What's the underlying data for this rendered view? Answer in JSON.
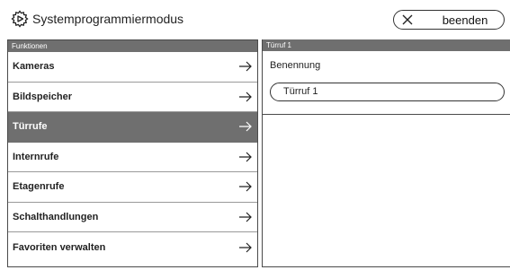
{
  "header": {
    "title": "Systemprogrammiermodus",
    "settings_icon": "gear-icon",
    "exit_icon": "close-icon",
    "exit_label": "beenden"
  },
  "left": {
    "section_title": "Funktionen",
    "items": [
      {
        "label": "Kameras",
        "icon": "arrow-right-icon",
        "active": false
      },
      {
        "label": "Bildspeicher",
        "icon": "arrow-right-icon",
        "active": false
      },
      {
        "label": "Türrufe",
        "icon": "arrow-right-icon",
        "active": true
      },
      {
        "label": "Internrufe",
        "icon": "arrow-right-icon",
        "active": false
      },
      {
        "label": "Etagenrufe",
        "icon": "arrow-right-icon",
        "active": false
      },
      {
        "label": "Schalthandlungen",
        "icon": "arrow-right-icon",
        "active": false
      },
      {
        "label": "Favoriten verwalten",
        "icon": "arrow-right-icon",
        "active": false
      }
    ]
  },
  "right": {
    "section_title": "Türruf 1",
    "field_label": "Benennung",
    "field_value": "Türruf 1"
  },
  "colors": {
    "section_bg": "#6f6f6f",
    "active_bg": "#6f6f6f",
    "text": "#222222",
    "border": "#4a4a4a"
  }
}
